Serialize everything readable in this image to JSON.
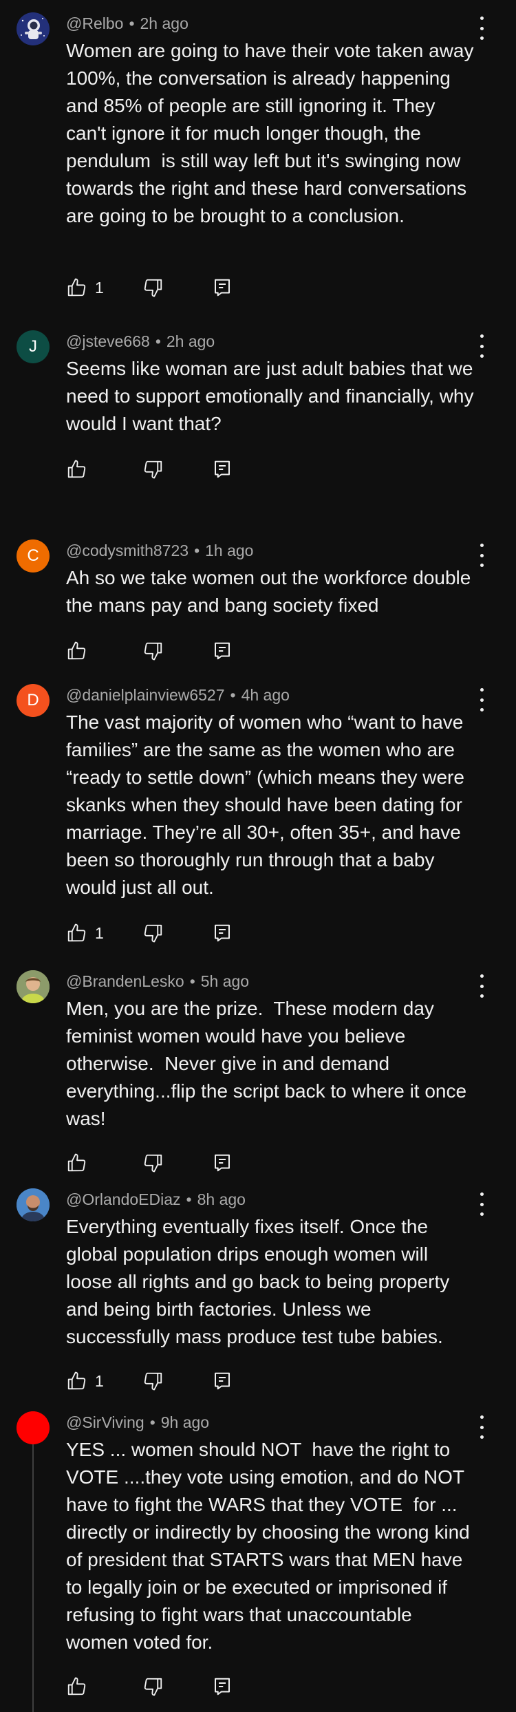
{
  "colors": {
    "background": "#0f0f0f",
    "text": "#f1f1f1",
    "meta_text": "#aaaaaa",
    "avatar_jsteve": "#0d4d44",
    "avatar_codysmith": "#ef6c00",
    "avatar_daniel": "#f4511e",
    "avatar_sirviving": "#ff0000"
  },
  "comments": [
    {
      "author": "@Relbo",
      "time": "2h ago",
      "avatar": {
        "type": "image",
        "icon": "astronaut-avatar-icon"
      },
      "text": "Women are going to have their vote taken away 100%, the conversation is already happening and 85% of people are still ignoring it. They can't ignore it for much longer though, the pendulum  is still way left but it's swinging now towards the right and these hard conversations are going to be brought to a conclusion.",
      "likes": "1"
    },
    {
      "author": "@jsteve668",
      "time": "2h ago",
      "avatar": {
        "type": "letter",
        "letter": "J"
      },
      "text": "Seems like woman are just adult babies that we need to support emotionally and financially, why would I want that?",
      "likes": ""
    },
    {
      "author": "@codysmith8723",
      "time": "1h ago",
      "avatar": {
        "type": "letter",
        "letter": "C"
      },
      "text": "Ah so we take women out the workforce double the mans pay and bang society fixed",
      "likes": ""
    },
    {
      "author": "@danielplainview6527",
      "time": "4h ago",
      "avatar": {
        "type": "letter",
        "letter": "D"
      },
      "text": "The vast majority of women who “want to have families” are the same as the women who are “ready to settle down” (which means they were skanks when they should have been dating for marriage. They’re all 30+, often 35+, and have been so thoroughly run through that a baby would just all out.",
      "likes": "1"
    },
    {
      "author": "@BrandenLesko",
      "time": "5h ago",
      "avatar": {
        "type": "image",
        "icon": "person-photo-avatar-icon"
      },
      "text": "Men, you are the prize.  These modern day feminist women would have you believe otherwise.  Never give in and demand everything...flip the script back to where it once was!",
      "likes": ""
    },
    {
      "author": "@OrlandoEDiaz",
      "time": "8h ago",
      "avatar": {
        "type": "image",
        "icon": "person-photo-avatar-icon"
      },
      "text": "Everything eventually fixes itself. Once the global population drips enough women will loose all rights and go back to being property and being birth factories. Unless we successfully mass produce test tube babies.",
      "likes": "1"
    },
    {
      "author": "@SirViving",
      "time": "9h ago",
      "avatar": {
        "type": "color",
        "icon": "red-circle-avatar-icon"
      },
      "text": "YES ... women should NOT  have the right to VOTE ....they vote using emotion, and do NOT have to fight the WARS that they VOTE  for ... directly or indirectly by choosing the wrong kind of president that STARTS wars that MEN have to legally join or be executed or imprisoned if refusing to fight wars that unaccountable women voted for.",
      "likes": ""
    }
  ]
}
